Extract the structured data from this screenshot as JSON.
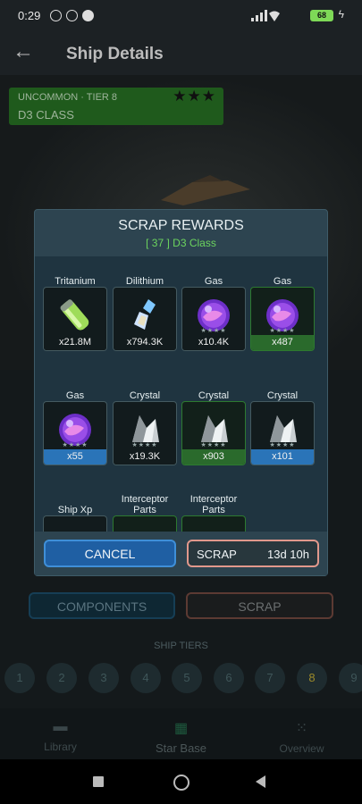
{
  "status_bar": {
    "time": "0:29",
    "battery": "68"
  },
  "header": {
    "title": "Ship Details"
  },
  "rank": {
    "rarity": "UNCOMMON · TIER 8",
    "stars": "★★★",
    "class": "D3 CLASS"
  },
  "modal": {
    "title": "SCRAP REWARDS",
    "subtitle": "[ 37 ] D3 Class",
    "rewards": [
      {
        "name": "Tritanium",
        "qty": "x21.8M",
        "icon": "tritanium-icon"
      },
      {
        "name": "Dilithium",
        "qty": "x794.3K",
        "icon": "dilithium-icon"
      },
      {
        "name": "Gas",
        "qty": "x10.4K",
        "icon": "gas-icon",
        "stars": "★★★★"
      },
      {
        "name": "Gas",
        "qty": "x487",
        "icon": "gas-icon",
        "stars": "★★★★"
      },
      {
        "name": "Gas",
        "qty": "x55",
        "icon": "gas-icon",
        "stars": "★★★★"
      },
      {
        "name": "Crystal",
        "qty": "x19.3K",
        "icon": "crystal-icon",
        "stars": "★★★★"
      },
      {
        "name": "Crystal",
        "qty": "x903",
        "icon": "crystal-icon",
        "stars": "★★★★"
      },
      {
        "name": "Crystal",
        "qty": "x101",
        "icon": "crystal-icon",
        "stars": "★★★★"
      },
      {
        "name": "Ship Xp",
        "icon": "ship-xp-icon"
      },
      {
        "name": "Interceptor Parts",
        "icon": "interceptor-parts-icon"
      },
      {
        "name": "Interceptor Parts",
        "icon": "interceptor-parts-icon"
      }
    ],
    "cancel_label": "CANCEL",
    "scrap_label": "SCRAP",
    "scrap_time": "13d 10h"
  },
  "actions": {
    "components_label": "COMPONENTS",
    "scrap_label": "SCRAP"
  },
  "tiers": {
    "label": "SHIP TIERS",
    "items": [
      "1",
      "2",
      "3",
      "4",
      "5",
      "6",
      "7",
      "8",
      "9"
    ],
    "current": "8"
  },
  "nav": {
    "library": "Library",
    "starbase": "Star Base",
    "overview": "Overview"
  }
}
